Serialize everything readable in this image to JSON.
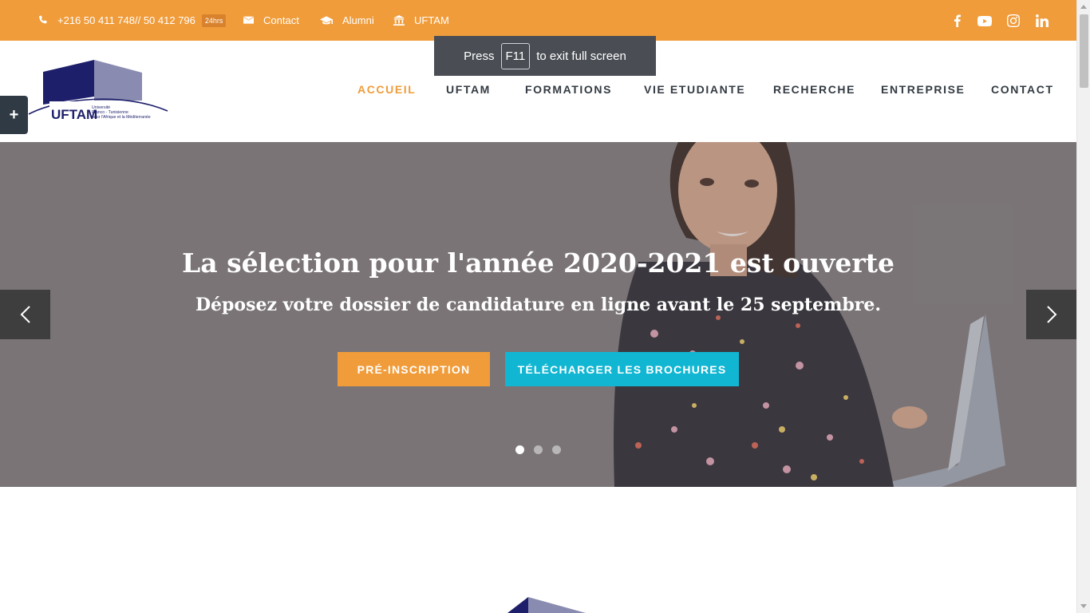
{
  "topbar": {
    "phone": "+216 50 411 748// 50 412 796",
    "phone_badge": "24hrs",
    "contact": "Contact",
    "alumni": "Alumni",
    "uftam": "UFTAM",
    "social": [
      "facebook-icon",
      "youtube-icon",
      "instagram-icon",
      "linkedin-icon"
    ]
  },
  "fullscreen": {
    "press": "Press",
    "key": "F11",
    "rest": "to exit full screen"
  },
  "logo": {
    "name": "UFTAM",
    "line1": "Université",
    "line2": "Franco - Tunisienne",
    "line3": "pour l'Afrique et la Méditerranée"
  },
  "nav": [
    "ACCUEIL",
    "UFTAM",
    "FORMATIONS",
    "VIE ETUDIANTE",
    "RECHERCHE",
    "ENTREPRISE",
    "CONTACT"
  ],
  "toggle": "+",
  "hero": {
    "title": "La sélection pour l'année 2020-2021 est ouverte",
    "subtitle": "Déposez votre dossier de candidature en ligne avant le 25 septembre.",
    "btn_primary": "PRÉ-INSCRIPTION",
    "btn_secondary": "TÉLÉCHARGER LES BROCHURES",
    "active_slide": 1,
    "slide_count": 3
  },
  "colors": {
    "accent": "#f09c3a",
    "cyan": "#11b6d2",
    "dark": "#333a42",
    "logo_navy": "#1d1f6b",
    "logo_gray": "#8a8bb0"
  }
}
